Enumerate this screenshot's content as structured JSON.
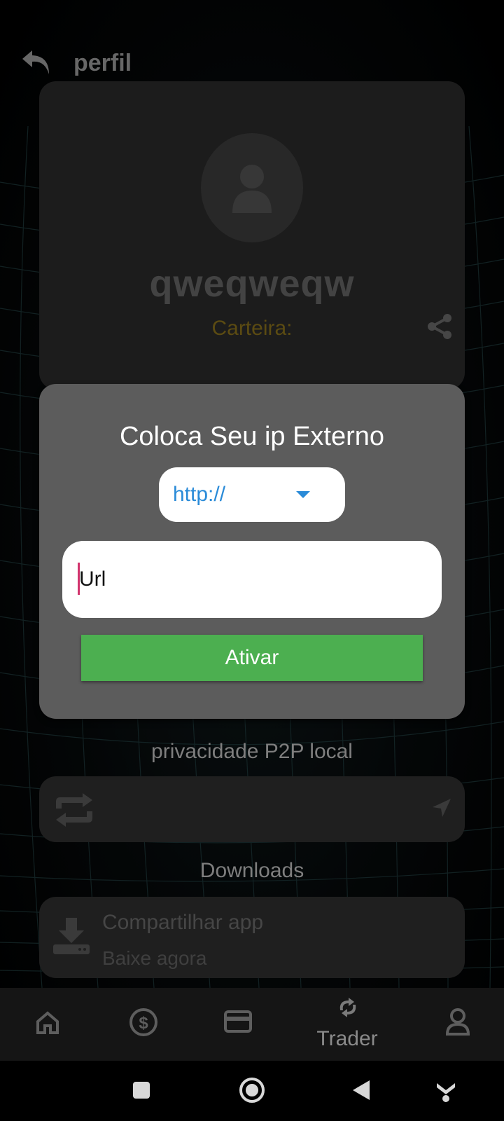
{
  "header": {
    "title": "perfil",
    "back_icon": "back-arrow-icon"
  },
  "profile": {
    "username": "qweqweqw",
    "wallet_label": "Carteira:",
    "share_icon": "share-icon",
    "avatar_icon": "person-icon"
  },
  "dialog": {
    "title": "Coloca Seu ip Externo",
    "protocol_selected": "http://",
    "url_placeholder": "Url",
    "activate_label": "Ativar"
  },
  "sections": {
    "p2p_label": "privacidade P2P local",
    "downloads_label": "Downloads"
  },
  "download_card": {
    "title": "Compartilhar app",
    "subtitle": "Baixe agora"
  },
  "bottom_nav": {
    "items": [
      {
        "icon": "home-icon",
        "label": ""
      },
      {
        "icon": "dollar-icon",
        "label": ""
      },
      {
        "icon": "card-icon",
        "label": ""
      },
      {
        "icon": "sync-icon",
        "label": "Trader"
      },
      {
        "icon": "user-icon",
        "label": ""
      }
    ]
  },
  "colors": {
    "accent_green": "#4caf50",
    "link_blue": "#2a8bd8",
    "wallet_gold": "#7a6418",
    "dialog_bg": "#5c5c5c"
  }
}
